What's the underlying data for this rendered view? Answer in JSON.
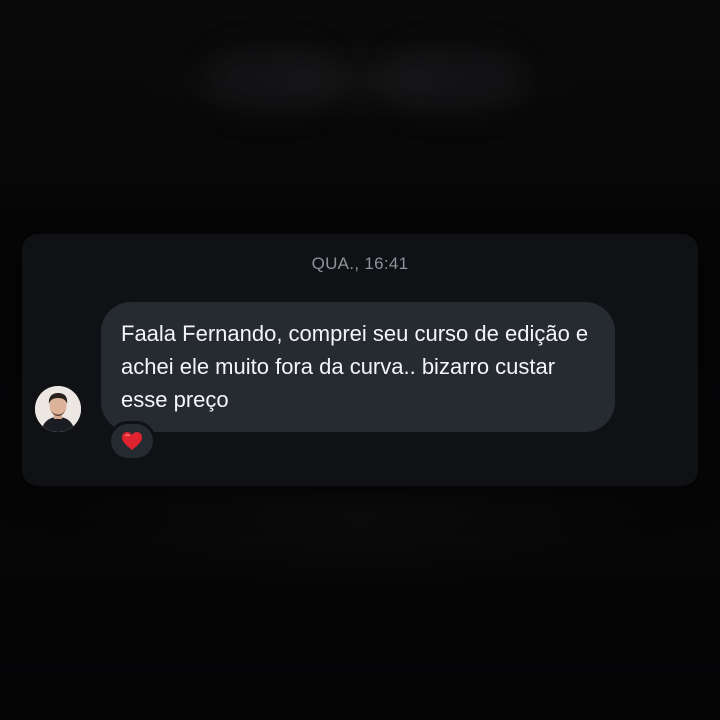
{
  "chat": {
    "timestamp": "QUA., 16:41",
    "message": {
      "text": "Faala Fernando, comprei seu curso de edição e achei ele muito fora da curva.. bizarro custar esse preço",
      "reaction": "heart-emoji"
    },
    "sender": {
      "avatar": "avatar-photo"
    }
  },
  "colors": {
    "background": "#050506",
    "card": "#0f1115",
    "bubble": "#262a31",
    "text": "#f4f5f7",
    "timestamp": "#8e9199",
    "heart": "#e0242f"
  }
}
